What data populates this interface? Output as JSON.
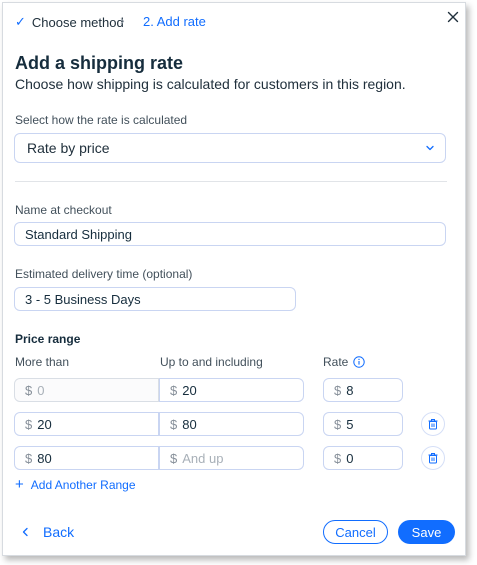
{
  "breadcrumb": {
    "step1": "Choose method",
    "separator": "›",
    "step2": "2.  Add rate"
  },
  "header": {
    "title": "Add a shipping rate",
    "subtitle": "Choose how shipping is calculated for customers in this region."
  },
  "calculation": {
    "label": "Select how the rate is calculated",
    "selected": "Rate by price"
  },
  "checkout_name": {
    "label": "Name at checkout",
    "value": "Standard Shipping"
  },
  "delivery_time": {
    "label": "Estimated delivery time (optional)",
    "value": "3 - 5 Business Days"
  },
  "price_range": {
    "heading": "Price range",
    "col_more_than": "More than",
    "col_up_to": "Up to and including",
    "col_rate": "Rate",
    "currency": "$",
    "rows": [
      {
        "more_than": "",
        "more_than_placeholder": "0",
        "up_to": "20",
        "up_to_placeholder": "",
        "rate": "8"
      },
      {
        "more_than": "20",
        "more_than_placeholder": "",
        "up_to": "80",
        "up_to_placeholder": "",
        "rate": "5"
      },
      {
        "more_than": "80",
        "more_than_placeholder": "",
        "up_to": "",
        "up_to_placeholder": "And up",
        "rate": "0"
      }
    ],
    "add_label": "Add Another Range"
  },
  "footer": {
    "back_label": "Back",
    "cancel_label": "Cancel",
    "save_label": "Save"
  },
  "icons": {
    "check": "check-icon",
    "close": "close-icon",
    "chevron": "chevron-down-icon",
    "info": "info-icon",
    "trash": "trash-icon",
    "plus": "plus-icon",
    "back": "chevron-left-icon"
  },
  "colors": {
    "accent": "#116dff",
    "text": "#162d3d",
    "border": "#c9d5f2"
  }
}
